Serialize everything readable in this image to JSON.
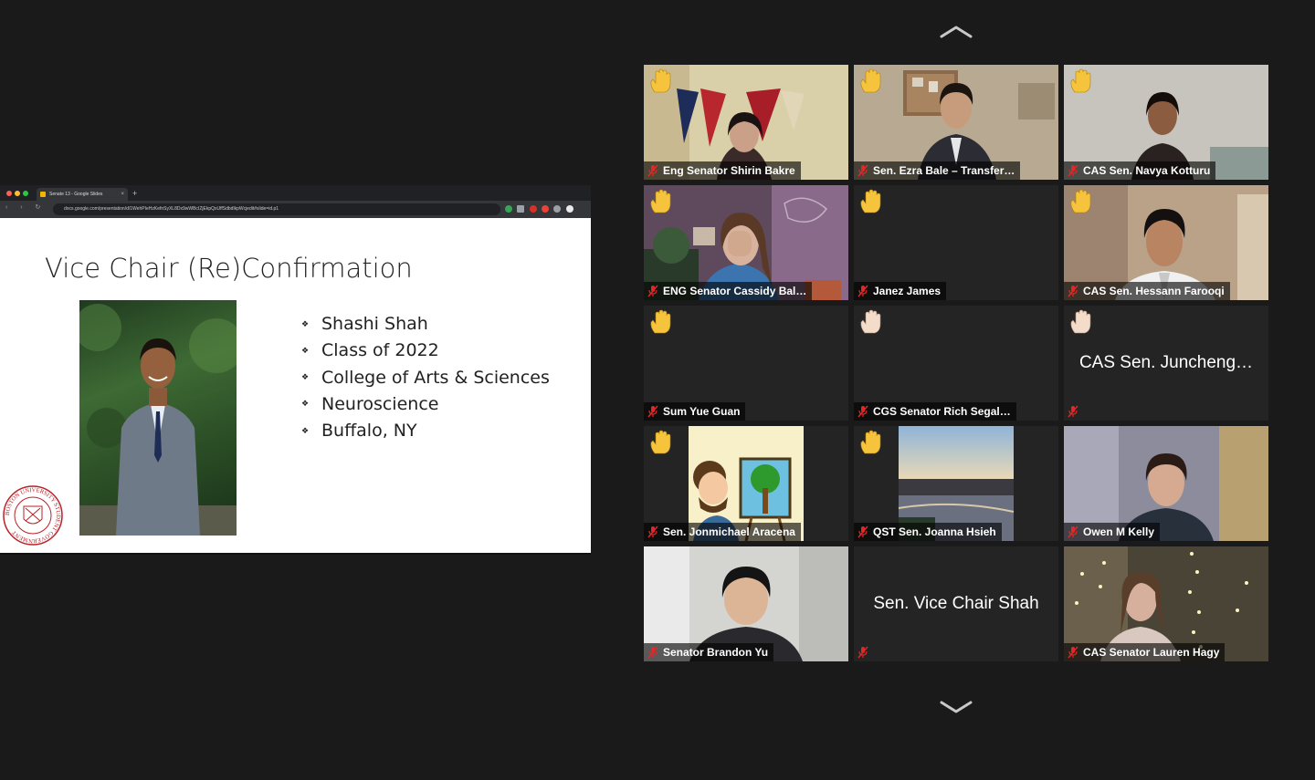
{
  "browser": {
    "tab_title": "Senate 13 - Google Slides",
    "tab_close": "×",
    "new_tab": "+",
    "nav": "‹ › ↻ ⌂",
    "url": "docs.google.com/presentation/d/1WehPIeHzKefnSyXL8Dx9wWBcIZjEkpQxUffSdbdlkpWcjedit#slide=id.p1"
  },
  "slide": {
    "title": "Vice Chair (Re)Confirmation",
    "bullet_glyph": "❖",
    "bullets": [
      "Shashi Shah",
      "Class of 2022",
      "College of Arts & Sciences",
      "Neuroscience",
      "Buffalo, NY"
    ],
    "seal_text": "BOSTON UNIVERSITY STUDENT GOVERNMENT"
  },
  "gallery": {
    "participants": [
      {
        "name": "Eng Senator Shirin Bakre",
        "raised_hand": true,
        "muted": true
      },
      {
        "name": "Sen. Ezra Bale – Transfer…",
        "raised_hand": true,
        "muted": true
      },
      {
        "name": "CAS Sen. Navya Kotturu",
        "raised_hand": true,
        "muted": true
      },
      {
        "name": "ENG Senator Cassidy Bal…",
        "raised_hand": true,
        "muted": true
      },
      {
        "name": "Janez James",
        "raised_hand": true,
        "muted": true
      },
      {
        "name": "CAS Sen. Hessann Farooqi",
        "raised_hand": true,
        "muted": true
      },
      {
        "name": "Sum Yue Guan",
        "raised_hand": true,
        "muted": true
      },
      {
        "name": "CGS Senator Rich Segal…",
        "raised_hand": true,
        "muted": true
      },
      {
        "name": "CAS Sen. Juncheng…",
        "raised_hand": true,
        "muted": true
      },
      {
        "name": "Sen. Jonmichael Aracena",
        "raised_hand": true,
        "muted": true
      },
      {
        "name": "QST Sen. Joanna Hsieh",
        "raised_hand": true,
        "muted": true
      },
      {
        "name": "Owen M Kelly",
        "raised_hand": false,
        "muted": true
      },
      {
        "name": "Senator Brandon Yu",
        "raised_hand": false,
        "muted": true
      },
      {
        "name": "Sen. Vice Chair Shah",
        "raised_hand": false,
        "muted": true
      },
      {
        "name": "CAS Senator Lauren Hagy",
        "raised_hand": false,
        "muted": true
      }
    ]
  },
  "colors": {
    "background": "#1a1a1a",
    "tile": "#242424",
    "muted_red": "#e02828",
    "hand_yellow": "#f6c33c"
  }
}
